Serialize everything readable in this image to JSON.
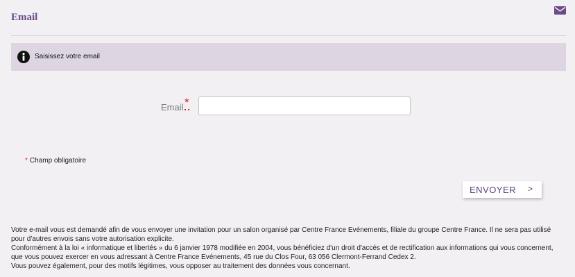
{
  "header": {
    "title": "Email",
    "mail_icon": "envelope-icon"
  },
  "info": {
    "icon": "info-circle-icon",
    "text": "Saisissez votre email"
  },
  "form": {
    "email_label": "Email",
    "required_marker": "*",
    "email_value": "",
    "email_placeholder": ""
  },
  "required_note": {
    "star": "*",
    "text": "Champ obligatoire"
  },
  "submit": {
    "label": "ENVOYER",
    "chevron": ">"
  },
  "footer": {
    "paragraphs": [
      "Votre e-mail vous est demandé afin de vous envoyer une invitation pour un salon organisé par Centre France Evénements, filiale du groupe Centre France. Il ne sera pas utilisé pour d'autres envois sans votre autorisation explicite.",
      "Conformément à la loi « informatique et libertés » du 6 janvier 1978 modifiée en 2004, vous bénéficiez d'un droit d'accès et de rectification aux informations qui vous concernent, que vous pouvez exercer en vous adressant à Centre France Evénements, 45 rue du Clos Four, 63 056 Clermont-Ferrand Cedex 2.",
      "Vous pouvez également, pour des motifs légitimes, vous opposer au traitement des données vous concernant."
    ]
  },
  "colors": {
    "accent": "#6b4a8a",
    "info_bar": "#ddd6e2",
    "background": "#f2f0f2",
    "required": "#e01f1f"
  }
}
